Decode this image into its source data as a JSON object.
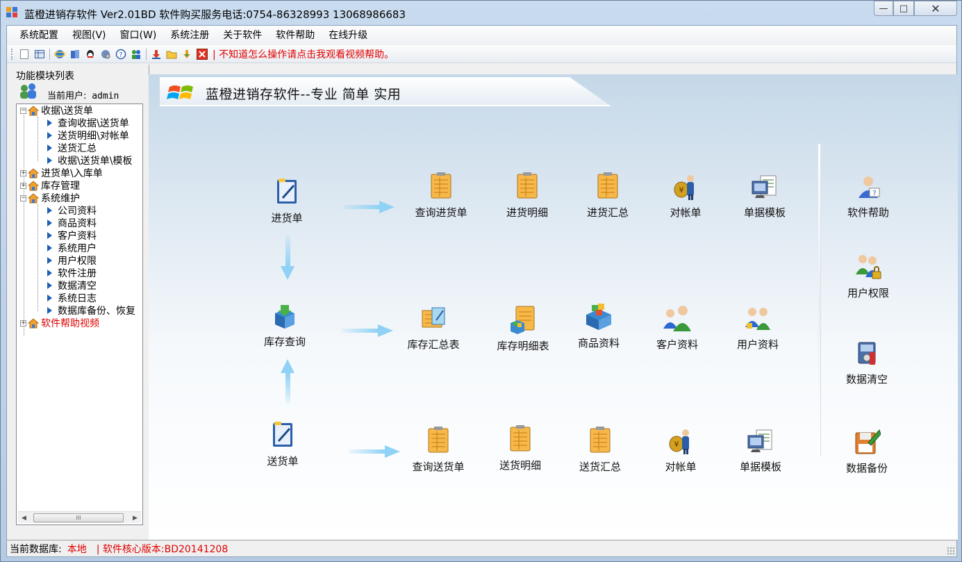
{
  "window": {
    "title": "蓝橙进销存软件 Ver2.01BD  软件购买服务电话:0754-86328993 13068986683",
    "min_label": "—",
    "max_label": "□",
    "close_label": "✕"
  },
  "menu": [
    "系统配置",
    "视图(V)",
    "窗口(W)",
    "系统注册",
    "关于软件",
    "软件帮助",
    "在线升级"
  ],
  "toolbar": {
    "help_text": "| 不知道怎么操作请点击我观看视频帮助。",
    "icons": [
      "new-icon",
      "grid-icon",
      "ie-icon",
      "books-icon",
      "qq-icon",
      "ie-settings-icon",
      "help-icon",
      "users-icon",
      "import-icon",
      "folder-icon",
      "download-icon",
      "close-red-icon"
    ]
  },
  "left_panel": {
    "title": "功能模块列表",
    "current_user_label": "当前用户:",
    "current_user": "admin",
    "tree": [
      {
        "label": "收据\\送货单",
        "type": "group",
        "expanded": true,
        "children": [
          "查询收据\\送货单",
          "送货明细\\对帐单",
          "送货汇总",
          "收据\\送货单\\模板"
        ]
      },
      {
        "label": "进货单\\入库单",
        "type": "group",
        "expanded": false
      },
      {
        "label": "库存管理",
        "type": "group",
        "expanded": false
      },
      {
        "label": "系统维护",
        "type": "group",
        "expanded": true,
        "children": [
          "公司资料",
          "商品资料",
          "客户资料",
          "系统用户",
          "用户权限",
          "软件注册",
          "数据清空",
          "系统日志",
          "数据库备份、恢复"
        ]
      },
      {
        "label": "软件帮助视频",
        "type": "group",
        "expanded": false,
        "highlight": "#e00000"
      }
    ],
    "scroll_thumb": "III"
  },
  "banner": {
    "title": "蓝橙进销存软件--专业 简单 实用"
  },
  "tiles": {
    "purchase_order": "进货单",
    "query_purchase": "查询进货单",
    "purchase_detail": "进货明细",
    "purchase_summary": "进货汇总",
    "statement_1": "对帐单",
    "template_1": "单据模板",
    "inventory_query": "库存查询",
    "inventory_summary": "库存汇总表",
    "inventory_detail": "库存明细表",
    "product_info": "商品资料",
    "customer_info": "客户资料",
    "user_info": "用户资料",
    "delivery_order": "送货单",
    "query_delivery": "查询送货单",
    "delivery_detail": "送货明细",
    "delivery_summary": "送货汇总",
    "statement_2": "对帐单",
    "template_2": "单据模板",
    "software_help": "软件帮助",
    "user_permission": "用户权限",
    "data_clear": "数据清空",
    "data_backup": "数据备份"
  },
  "status": {
    "db_label": "当前数据库:",
    "db_value": "本地",
    "version_label": "| 软件核心版本:BD20141208"
  },
  "colors": {
    "accent_red": "#e00000",
    "tree_arrow": "#1d5fb3",
    "flow_arrow": "#8fd2f5"
  }
}
